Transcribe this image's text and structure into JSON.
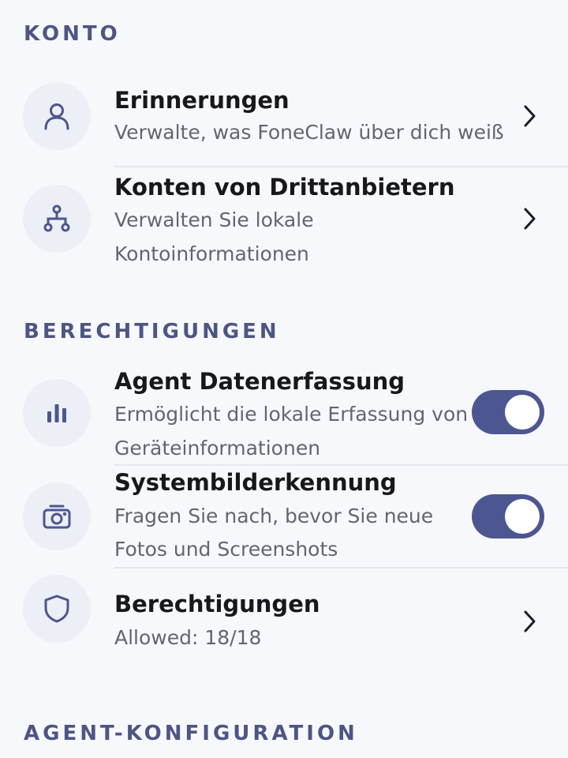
{
  "sections": {
    "account": "KONTO",
    "permissions": "BERECHTIGUNGEN",
    "agent_config": "AGENT-KONFIGURATION"
  },
  "items": {
    "memories": {
      "title": "Erinnerungen",
      "subtitle": "Verwalte, was FoneClaw über dich weiß",
      "icon": "person-icon"
    },
    "third_party": {
      "title": "Konten von Drittanbietern",
      "subtitle_line1": "Verwalten Sie lokale",
      "subtitle_line2": "Kontoinformationen",
      "icon": "network-icon"
    },
    "data_collection": {
      "title": "Agent Datenerfassung",
      "subtitle_line1": "Ermöglicht die lokale Erfassung von",
      "subtitle_line2": "Geräteinformationen",
      "icon": "bar-chart-icon",
      "enabled": true
    },
    "image_recognition": {
      "title": "Systembilderkennung",
      "subtitle_line1": "Fragen Sie nach, bevor Sie neue",
      "subtitle_line2": "Fotos und Screenshots",
      "icon": "camera-icon",
      "enabled": true
    },
    "permissions": {
      "title": "Berechtigungen",
      "subtitle": "Allowed: 18/18",
      "icon": "shield-icon"
    }
  },
  "colors": {
    "accent": "#4c5690",
    "section_header": "#4d5585",
    "icon_bg": "#edeff6",
    "background": "#f7f8fb"
  }
}
